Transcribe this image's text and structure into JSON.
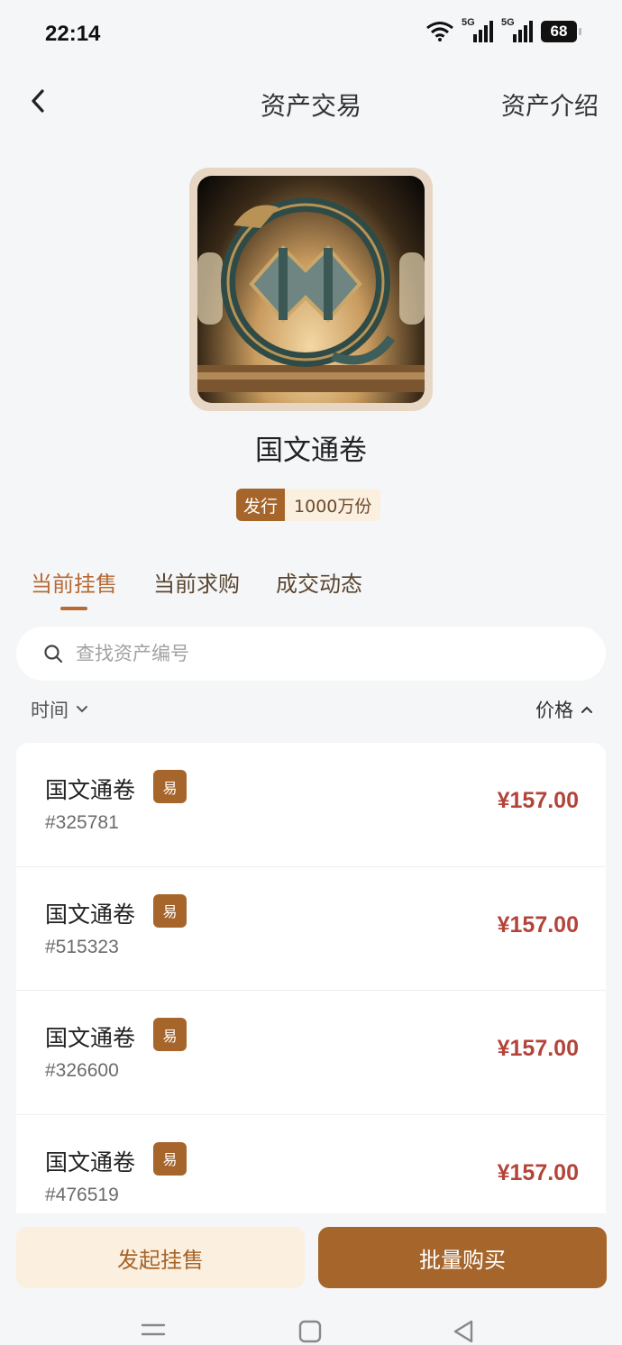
{
  "status": {
    "time": "22:14",
    "battery": "68",
    "signal1": "5G",
    "signal2": "5G"
  },
  "nav": {
    "title": "资产交易",
    "right_link": "资产介绍"
  },
  "asset": {
    "name": "国文通卷",
    "issue_label": "发行",
    "issue_amount": "1000万份"
  },
  "tabs": [
    {
      "label": "当前挂售",
      "active": true
    },
    {
      "label": "当前求购",
      "active": false
    },
    {
      "label": "成交动态",
      "active": false
    }
  ],
  "search": {
    "placeholder": "查找资产编号"
  },
  "sort": {
    "time_label": "时间",
    "price_label": "价格"
  },
  "listings": [
    {
      "name": "国文通卷",
      "badge": "易",
      "id": "#325781",
      "price": "¥157.00"
    },
    {
      "name": "国文通卷",
      "badge": "易",
      "id": "#515323",
      "price": "¥157.00"
    },
    {
      "name": "国文通卷",
      "badge": "易",
      "id": "#326600",
      "price": "¥157.00"
    },
    {
      "name": "国文通卷",
      "badge": "易",
      "id": "#476519",
      "price": "¥157.00"
    }
  ],
  "actions": {
    "sell_label": "发起挂售",
    "buy_label": "批量购买"
  },
  "colors": {
    "accent": "#a6652a",
    "price": "#b4443a",
    "tab_active": "#b76a33",
    "background": "#f5f6f8"
  }
}
